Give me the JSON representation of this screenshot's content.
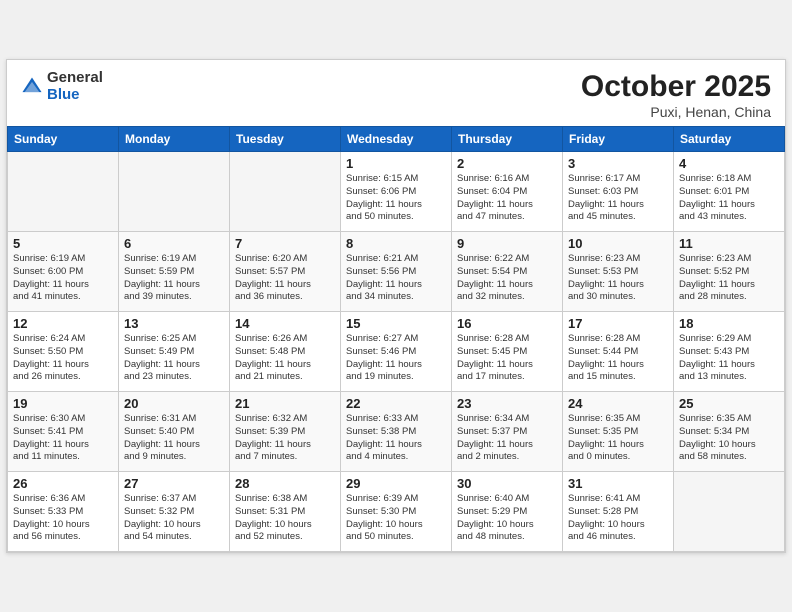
{
  "header": {
    "logo_general": "General",
    "logo_blue": "Blue",
    "month": "October 2025",
    "location": "Puxi, Henan, China"
  },
  "weekdays": [
    "Sunday",
    "Monday",
    "Tuesday",
    "Wednesday",
    "Thursday",
    "Friday",
    "Saturday"
  ],
  "weeks": [
    [
      {
        "day": "",
        "info": ""
      },
      {
        "day": "",
        "info": ""
      },
      {
        "day": "",
        "info": ""
      },
      {
        "day": "1",
        "info": "Sunrise: 6:15 AM\nSunset: 6:06 PM\nDaylight: 11 hours\nand 50 minutes."
      },
      {
        "day": "2",
        "info": "Sunrise: 6:16 AM\nSunset: 6:04 PM\nDaylight: 11 hours\nand 47 minutes."
      },
      {
        "day": "3",
        "info": "Sunrise: 6:17 AM\nSunset: 6:03 PM\nDaylight: 11 hours\nand 45 minutes."
      },
      {
        "day": "4",
        "info": "Sunrise: 6:18 AM\nSunset: 6:01 PM\nDaylight: 11 hours\nand 43 minutes."
      }
    ],
    [
      {
        "day": "5",
        "info": "Sunrise: 6:19 AM\nSunset: 6:00 PM\nDaylight: 11 hours\nand 41 minutes."
      },
      {
        "day": "6",
        "info": "Sunrise: 6:19 AM\nSunset: 5:59 PM\nDaylight: 11 hours\nand 39 minutes."
      },
      {
        "day": "7",
        "info": "Sunrise: 6:20 AM\nSunset: 5:57 PM\nDaylight: 11 hours\nand 36 minutes."
      },
      {
        "day": "8",
        "info": "Sunrise: 6:21 AM\nSunset: 5:56 PM\nDaylight: 11 hours\nand 34 minutes."
      },
      {
        "day": "9",
        "info": "Sunrise: 6:22 AM\nSunset: 5:54 PM\nDaylight: 11 hours\nand 32 minutes."
      },
      {
        "day": "10",
        "info": "Sunrise: 6:23 AM\nSunset: 5:53 PM\nDaylight: 11 hours\nand 30 minutes."
      },
      {
        "day": "11",
        "info": "Sunrise: 6:23 AM\nSunset: 5:52 PM\nDaylight: 11 hours\nand 28 minutes."
      }
    ],
    [
      {
        "day": "12",
        "info": "Sunrise: 6:24 AM\nSunset: 5:50 PM\nDaylight: 11 hours\nand 26 minutes."
      },
      {
        "day": "13",
        "info": "Sunrise: 6:25 AM\nSunset: 5:49 PM\nDaylight: 11 hours\nand 23 minutes."
      },
      {
        "day": "14",
        "info": "Sunrise: 6:26 AM\nSunset: 5:48 PM\nDaylight: 11 hours\nand 21 minutes."
      },
      {
        "day": "15",
        "info": "Sunrise: 6:27 AM\nSunset: 5:46 PM\nDaylight: 11 hours\nand 19 minutes."
      },
      {
        "day": "16",
        "info": "Sunrise: 6:28 AM\nSunset: 5:45 PM\nDaylight: 11 hours\nand 17 minutes."
      },
      {
        "day": "17",
        "info": "Sunrise: 6:28 AM\nSunset: 5:44 PM\nDaylight: 11 hours\nand 15 minutes."
      },
      {
        "day": "18",
        "info": "Sunrise: 6:29 AM\nSunset: 5:43 PM\nDaylight: 11 hours\nand 13 minutes."
      }
    ],
    [
      {
        "day": "19",
        "info": "Sunrise: 6:30 AM\nSunset: 5:41 PM\nDaylight: 11 hours\nand 11 minutes."
      },
      {
        "day": "20",
        "info": "Sunrise: 6:31 AM\nSunset: 5:40 PM\nDaylight: 11 hours\nand 9 minutes."
      },
      {
        "day": "21",
        "info": "Sunrise: 6:32 AM\nSunset: 5:39 PM\nDaylight: 11 hours\nand 7 minutes."
      },
      {
        "day": "22",
        "info": "Sunrise: 6:33 AM\nSunset: 5:38 PM\nDaylight: 11 hours\nand 4 minutes."
      },
      {
        "day": "23",
        "info": "Sunrise: 6:34 AM\nSunset: 5:37 PM\nDaylight: 11 hours\nand 2 minutes."
      },
      {
        "day": "24",
        "info": "Sunrise: 6:35 AM\nSunset: 5:35 PM\nDaylight: 11 hours\nand 0 minutes."
      },
      {
        "day": "25",
        "info": "Sunrise: 6:35 AM\nSunset: 5:34 PM\nDaylight: 10 hours\nand 58 minutes."
      }
    ],
    [
      {
        "day": "26",
        "info": "Sunrise: 6:36 AM\nSunset: 5:33 PM\nDaylight: 10 hours\nand 56 minutes."
      },
      {
        "day": "27",
        "info": "Sunrise: 6:37 AM\nSunset: 5:32 PM\nDaylight: 10 hours\nand 54 minutes."
      },
      {
        "day": "28",
        "info": "Sunrise: 6:38 AM\nSunset: 5:31 PM\nDaylight: 10 hours\nand 52 minutes."
      },
      {
        "day": "29",
        "info": "Sunrise: 6:39 AM\nSunset: 5:30 PM\nDaylight: 10 hours\nand 50 minutes."
      },
      {
        "day": "30",
        "info": "Sunrise: 6:40 AM\nSunset: 5:29 PM\nDaylight: 10 hours\nand 48 minutes."
      },
      {
        "day": "31",
        "info": "Sunrise: 6:41 AM\nSunset: 5:28 PM\nDaylight: 10 hours\nand 46 minutes."
      },
      {
        "day": "",
        "info": ""
      }
    ]
  ]
}
